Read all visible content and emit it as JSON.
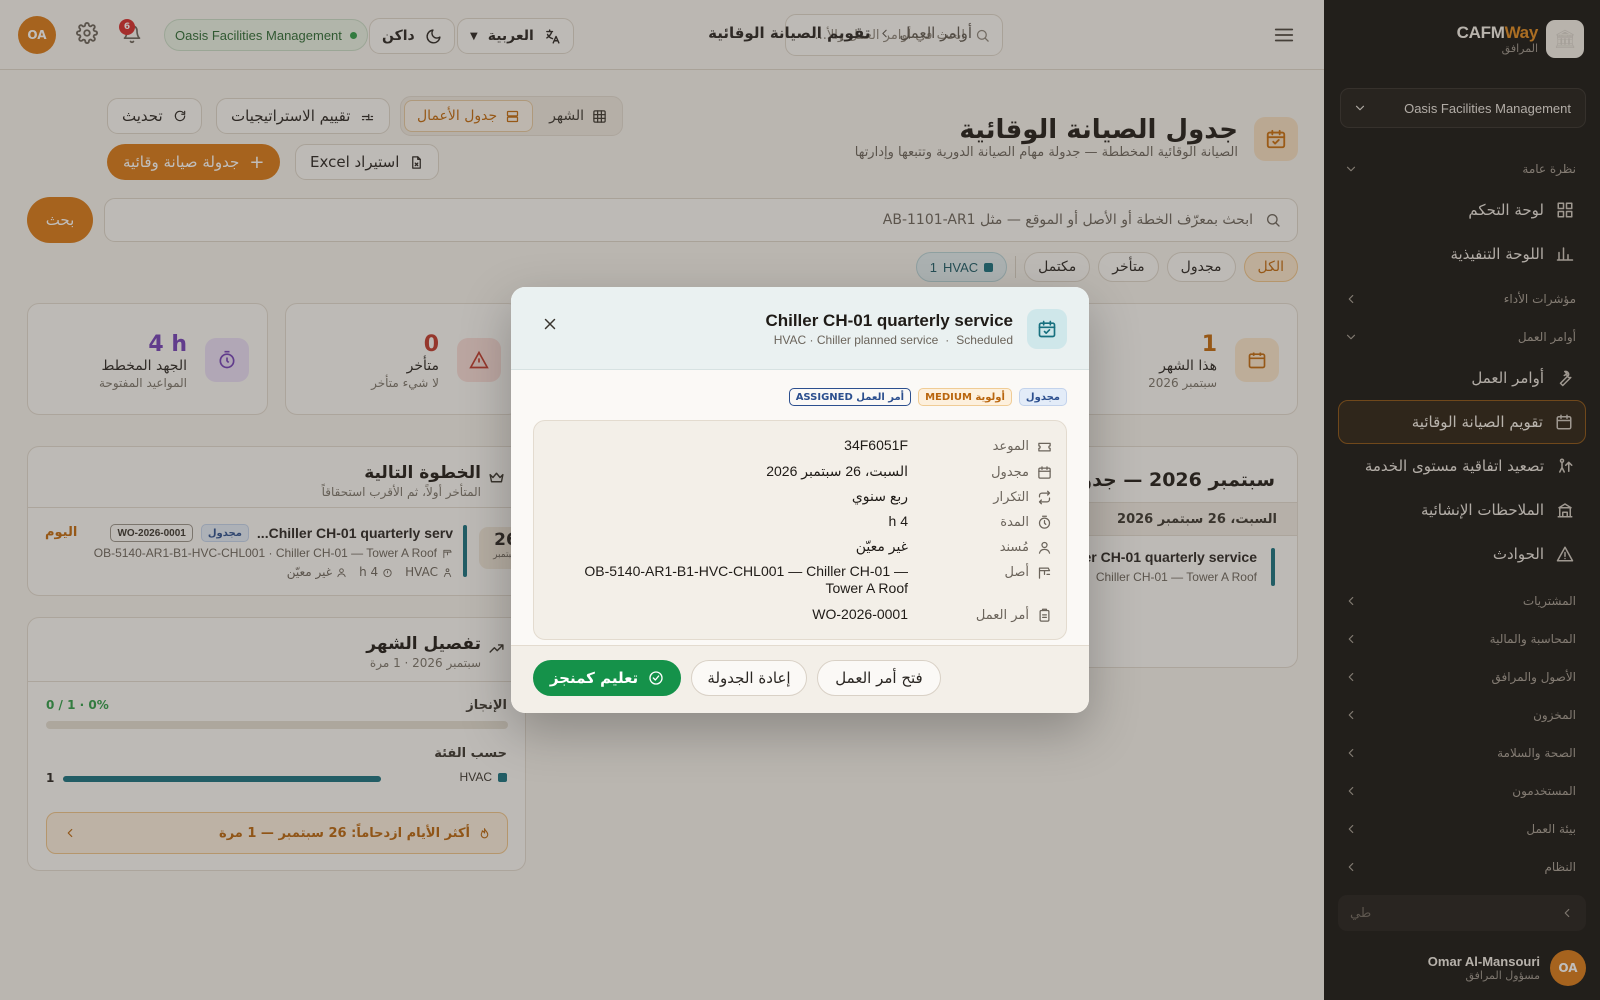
{
  "sidebar": {
    "brand_a": "CAFM",
    "brand_b": "Way",
    "brand_sub": "المرافق",
    "org": "Oasis Facilities Management",
    "sections": {
      "overview": "نظرة عامة",
      "kpi": "مؤشرات الأداء",
      "work_orders": "أوامر العمل",
      "procurement": "المشتريات",
      "finance": "المحاسبة والمالية",
      "assets": "الأصول والمرافق",
      "inventory": "المخزون",
      "hse": "الصحة والسلامة",
      "users": "المستخدمون",
      "workplace": "بيئة العمل",
      "system": "النظام"
    },
    "items": {
      "dashboard": "لوحة التحكم",
      "executive": "اللوحة التنفيذية",
      "work_orders": "أوامر العمل",
      "pm_calendar": "تقويم الصيانة الوقائية",
      "sla": "تصعيد اتفاقية مستوى الخدمة",
      "structural": "الملاحظات الإنشائية",
      "incidents": "الحوادث"
    },
    "search_placeholder": "طي",
    "user_name": "Omar Al-Mansouri",
    "user_role": "مسؤول المرافق",
    "user_initials": "OA"
  },
  "topbar": {
    "avatar": "OA",
    "bell_count": "6",
    "org": "Oasis Facilities Management",
    "theme": "داكن",
    "language": "العربية",
    "search_placeholder": "ابحث في أوامر العمل والأ...",
    "crumb_parent": "أوامر العمل",
    "crumb_current": "تقويم الصيانة الوقائية"
  },
  "page": {
    "title": "جدول الصيانة الوقائية",
    "subtitle": "الصيانة الوقائية المخططة — جدولة مهام الصيانة الدورية وتتبعها وإدارتها",
    "view_month": "الشهر",
    "view_agenda": "جدول الأعمال",
    "strategies": "تقييم الاستراتيجيات",
    "refresh": "تحديث",
    "schedule_pm": "جدولة صيانة وقائية",
    "import_excel": "استيراد Excel",
    "search_placeholder": "ابحث بمعرّف الخطة أو الأصل أو الموقع — مثل AB-1101-AR1",
    "search_btn": "بحث",
    "filters": [
      "الكل",
      "مجدول",
      "متأخر",
      "مكتمل"
    ],
    "filter_hvac_label": "HVAC",
    "filter_hvac_count": "1",
    "stats": {
      "month_num": "1",
      "month_label": "هذا الشهر",
      "month_sub": "سبتمبر 2026",
      "overdue_num": "0",
      "overdue_label": "متأخر",
      "overdue_sub": "لا شيء متأخر",
      "effort_num": "4 h",
      "effort_label": "الجهد المخطط",
      "effort_sub": "المواعيد المفتوحة"
    },
    "agenda": {
      "title": "سبتمبر 2026 — جدول الأعمال",
      "day": "السبت، 26 سبتمبر 2026",
      "item_title": "Chiller CH-01 quarterly service",
      "item_sub": "Chiller CH-01 — Tower A Roof"
    },
    "next": {
      "title": "الخطوة التالية",
      "sub": "المتأخر أولاً، ثم الأقرب استحقاقاً",
      "day_num": "26",
      "day_month": "سبتمبر",
      "item_title": "Chiller CH-01 quarterly serv...",
      "badge": "مجدول",
      "wo": "WO-2026-0001",
      "today": "اليوم",
      "line": "OB-5140-AR1-B1-HVC-CHL001 · Chiller CH-01 — Tower A Roof",
      "cat": "HVAC",
      "hours": "4 h",
      "assignee": "غير معيّن"
    },
    "breakdown": {
      "title": "تفصيل الشهر",
      "sub": "سبتمبر 2026 · 1 مرة",
      "completion_label": "الإنجاز",
      "completion_value": "0 / 1 · 0%",
      "completion_fraction": 0,
      "by_cat_label": "حسب الفئة",
      "cat_name": "HVAC",
      "cat_count": "1",
      "cat_fraction": 1,
      "busiest": "أكثر الأيام ازدحاماً: 26 سبتمبر — 1 مرة"
    }
  },
  "modal": {
    "title": "Chiller CH-01 quarterly service",
    "sub_left": "HVAC · Chiller planned service",
    "sub_dot": "·",
    "sub_status": "Scheduled",
    "badges": [
      "مجدول",
      "أولوية MEDIUM",
      "أمر العمل ASSIGNED"
    ],
    "details": [
      {
        "label": "الموعد",
        "value": "34F6051F",
        "icon": "ticket-icon"
      },
      {
        "label": "مجدول",
        "value": "السبت، 26 سبتمبر 2026",
        "icon": "calendar-icon"
      },
      {
        "label": "التكرار",
        "value": "ربع سنوي",
        "icon": "repeat-icon"
      },
      {
        "label": "المدة",
        "value": "4 h",
        "icon": "timer-icon"
      },
      {
        "label": "مُسند",
        "value": "غير معيّن",
        "icon": "user-icon"
      },
      {
        "label": "أصل",
        "value": "OB-5140-AR1-B1-HVC-CHL001 — Chiller CH-01 — Tower A Roof",
        "icon": "crane-icon"
      },
      {
        "label": "أمر العمل",
        "value": "WO-2026-0001",
        "icon": "clipboard-icon"
      }
    ],
    "open_wo": "فتح أمر العمل",
    "reschedule": "إعادة الجدولة",
    "mark_done": "تعليم كمنجز"
  },
  "colors": {
    "accent": "#d97a17",
    "teal": "#17707f",
    "green": "#15924a",
    "sidebar_bg": "#171513"
  }
}
